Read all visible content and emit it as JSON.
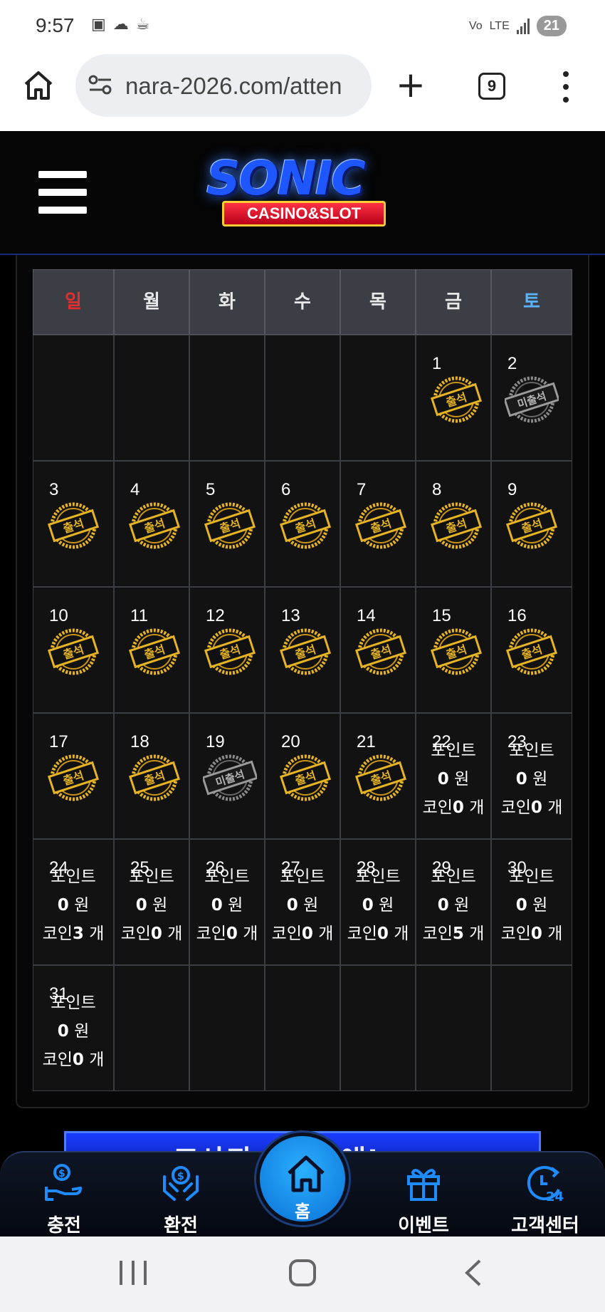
{
  "status_bar": {
    "time": "9:57",
    "network": "LTE",
    "battery": "21"
  },
  "browser": {
    "url": "nara-2026.com/atten",
    "tab_count": "9"
  },
  "site": {
    "logo_main": "SONIC",
    "logo_sub": "CASINO&SLOT"
  },
  "calendar": {
    "weekdays": [
      "일",
      "월",
      "화",
      "수",
      "목",
      "금",
      "토"
    ],
    "attended_label": "출석",
    "missed_label": "미출석",
    "point_label": "포인트",
    "won_unit": "원",
    "coin_label": "코인",
    "count_unit": "개",
    "rows": [
      [
        {
          "day": "",
          "state": "empty"
        },
        {
          "day": "",
          "state": "empty"
        },
        {
          "day": "",
          "state": "empty"
        },
        {
          "day": "",
          "state": "empty"
        },
        {
          "day": "",
          "state": "empty"
        },
        {
          "day": "1",
          "state": "attended"
        },
        {
          "day": "2",
          "state": "missed"
        }
      ],
      [
        {
          "day": "3",
          "state": "attended"
        },
        {
          "day": "4",
          "state": "attended"
        },
        {
          "day": "5",
          "state": "attended"
        },
        {
          "day": "6",
          "state": "attended"
        },
        {
          "day": "7",
          "state": "attended"
        },
        {
          "day": "8",
          "state": "attended"
        },
        {
          "day": "9",
          "state": "attended"
        }
      ],
      [
        {
          "day": "10",
          "state": "attended"
        },
        {
          "day": "11",
          "state": "attended"
        },
        {
          "day": "12",
          "state": "attended"
        },
        {
          "day": "13",
          "state": "attended"
        },
        {
          "day": "14",
          "state": "attended"
        },
        {
          "day": "15",
          "state": "attended"
        },
        {
          "day": "16",
          "state": "attended"
        }
      ],
      [
        {
          "day": "17",
          "state": "attended"
        },
        {
          "day": "18",
          "state": "attended"
        },
        {
          "day": "19",
          "state": "missed"
        },
        {
          "day": "20",
          "state": "attended"
        },
        {
          "day": "21",
          "state": "attended"
        },
        {
          "day": "22",
          "state": "reward",
          "points": "0",
          "coins": "0"
        },
        {
          "day": "23",
          "state": "reward",
          "points": "0",
          "coins": "0"
        }
      ],
      [
        {
          "day": "24",
          "state": "reward",
          "points": "0",
          "coins": "3"
        },
        {
          "day": "25",
          "state": "reward",
          "points": "0",
          "coins": "0"
        },
        {
          "day": "26",
          "state": "reward",
          "points": "0",
          "coins": "0"
        },
        {
          "day": "27",
          "state": "reward",
          "points": "0",
          "coins": "0"
        },
        {
          "day": "28",
          "state": "reward",
          "points": "0",
          "coins": "0"
        },
        {
          "day": "29",
          "state": "reward",
          "points": "0",
          "coins": "5"
        },
        {
          "day": "30",
          "state": "reward",
          "points": "0",
          "coins": "0"
        }
      ],
      [
        {
          "day": "31",
          "state": "reward",
          "points": "0",
          "coins": "0"
        },
        {
          "day": "",
          "state": "empty"
        },
        {
          "day": "",
          "state": "empty"
        },
        {
          "day": "",
          "state": "empty"
        },
        {
          "day": "",
          "state": "empty"
        },
        {
          "day": "",
          "state": "empty"
        },
        {
          "day": "",
          "state": "empty"
        }
      ]
    ]
  },
  "banner": {
    "text": "고사퇴 ... 왜 애!"
  },
  "bottom_nav": {
    "charge": "충전",
    "exchange": "환전",
    "home": "홈",
    "event": "이벤트",
    "support": "고객센터"
  },
  "colors": {
    "accent": "#1e8cff",
    "gold": "#e6b422",
    "sunday": "#e03030",
    "saturday": "#5ab4ff"
  }
}
